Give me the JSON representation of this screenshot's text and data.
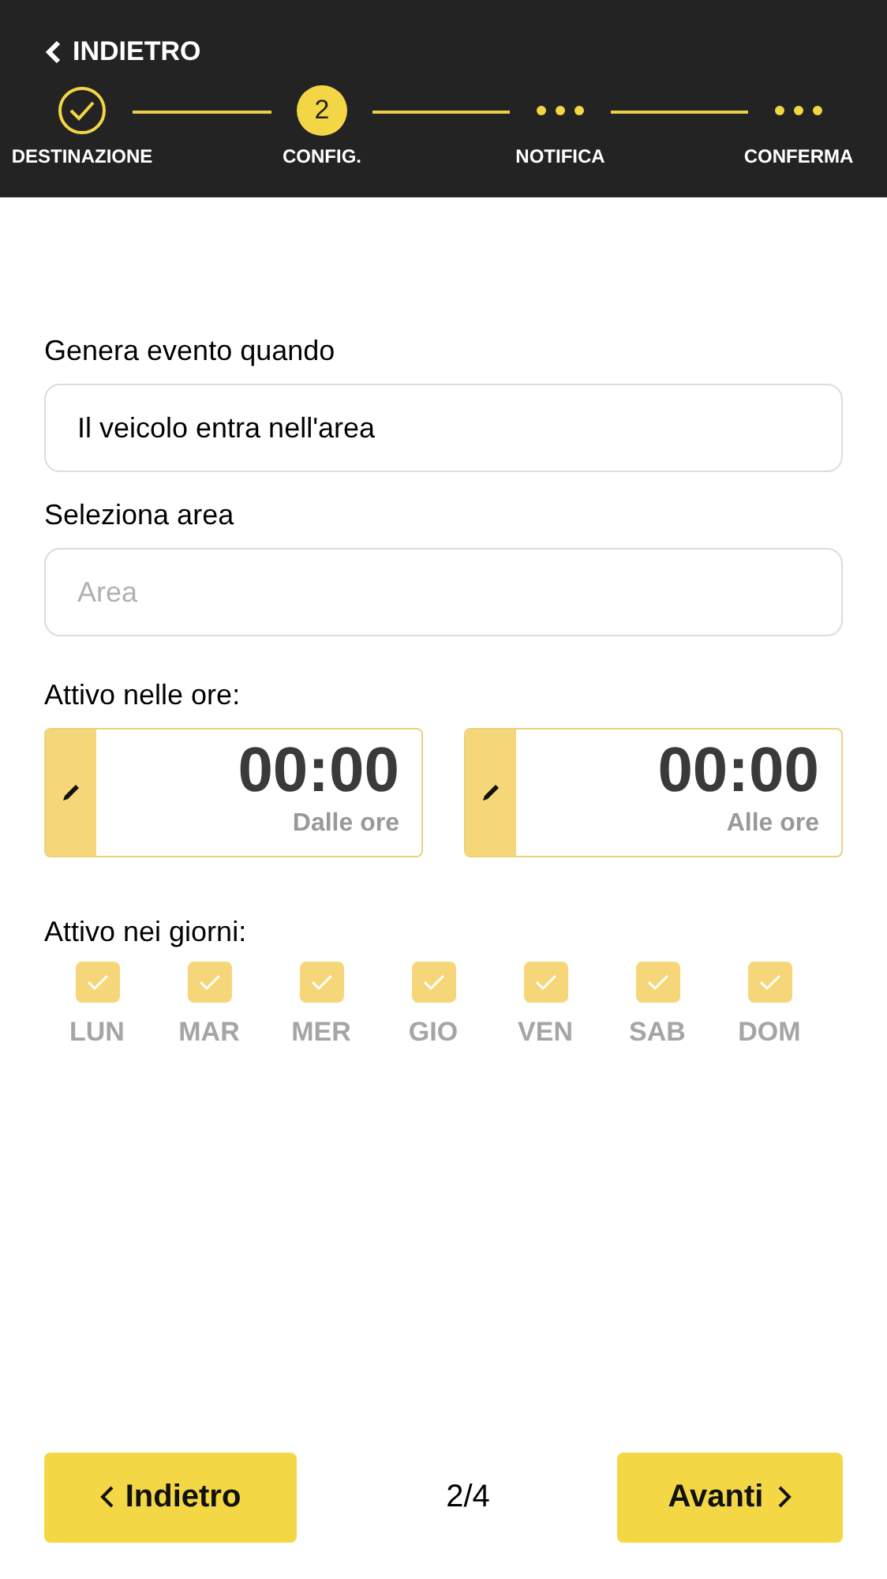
{
  "header": {
    "back_label": "INDIETRO"
  },
  "steps": [
    {
      "kind": "done",
      "label": "DESTINAZIONE"
    },
    {
      "kind": "current",
      "number": "2",
      "label": "CONFIG."
    },
    {
      "kind": "pending",
      "label": "NOTIFICA"
    },
    {
      "kind": "pending",
      "label": "CONFERMA"
    }
  ],
  "event_field": {
    "label": "Genera evento quando",
    "value": "Il veicolo entra nell'area"
  },
  "area_field": {
    "label": "Seleziona area",
    "placeholder": "Area"
  },
  "hours": {
    "label": "Attivo nelle ore:",
    "times": [
      {
        "value": "00:00",
        "caption": "Dalle ore"
      },
      {
        "value": "00:00",
        "caption": "Alle ore"
      }
    ]
  },
  "days": {
    "label": "Attivo nei giorni:",
    "items": [
      {
        "label": "LUN",
        "checked": true
      },
      {
        "label": "MAR",
        "checked": true
      },
      {
        "label": "MER",
        "checked": true
      },
      {
        "label": "GIO",
        "checked": true
      },
      {
        "label": "VEN",
        "checked": true
      },
      {
        "label": "SAB",
        "checked": true
      },
      {
        "label": "DOM",
        "checked": true
      }
    ]
  },
  "footer": {
    "back_button": "Indietro",
    "page": "2/4",
    "next_button": "Avanti"
  }
}
